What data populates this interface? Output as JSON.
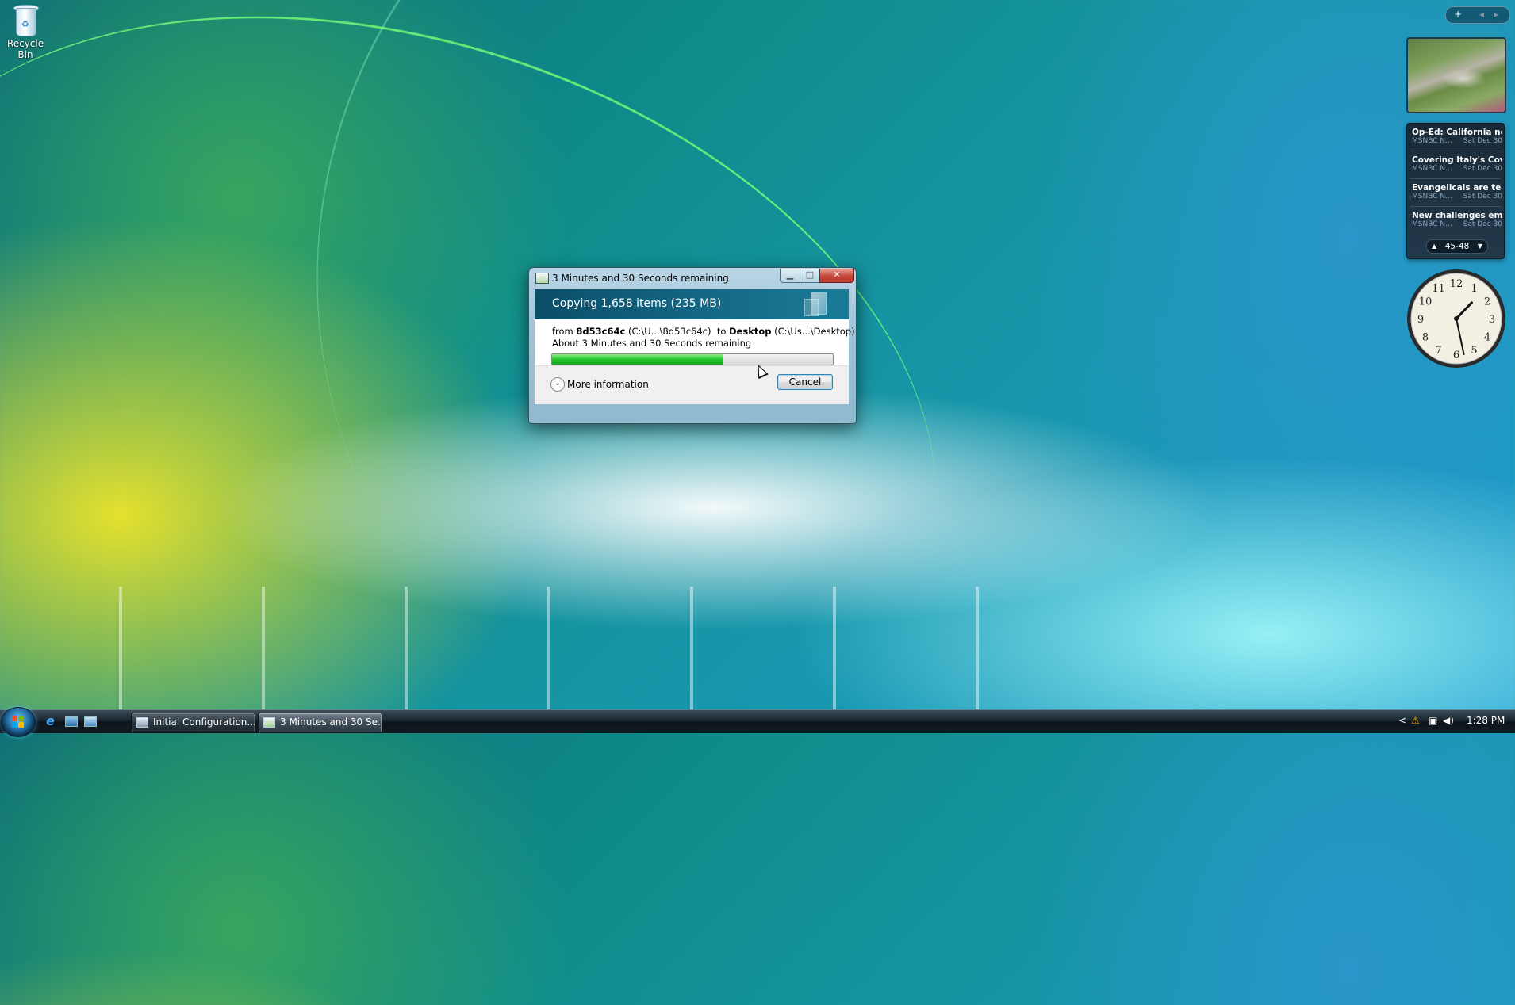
{
  "desktop": {
    "icons": [
      {
        "label": "Recycle Bin",
        "icon": "recycle-bin-icon"
      }
    ]
  },
  "dialog": {
    "title": "3 Minutes and 30 Seconds remaining",
    "heading": "Copying 1,658 items (235 MB)",
    "from_label": "from",
    "from_name": "8d53c64c",
    "from_path": "(C:\\U...\\8d53c64c)",
    "to_label": "to",
    "to_name": "Desktop",
    "to_path": "(C:\\Us...\\Desktop)",
    "status": "About 3 Minutes and 30 Seconds remaining",
    "progress": 0.61,
    "progress_color": "#23c42a",
    "more_info": "More information",
    "cancel": "Cancel",
    "controls": {
      "minimize": "minimize-icon",
      "maximize": "maximize-icon",
      "close": "close-icon"
    }
  },
  "sidebar": {
    "controls": {
      "add": "+",
      "prev": "◂",
      "next": "▸"
    },
    "news": {
      "items": [
        {
          "title": "Op-Ed: California nee...",
          "source": "MSNBC N...",
          "date": "Sat Dec 30"
        },
        {
          "title": "Covering Italy's Covi...",
          "source": "MSNBC N...",
          "date": "Sat Dec 30"
        },
        {
          "title": "Evangelicals are teac...",
          "source": "MSNBC N...",
          "date": "Sat Dec 30"
        },
        {
          "title": "New challenges eme...",
          "source": "MSNBC N...",
          "date": "Sat Dec 30"
        }
      ],
      "page": "45-48"
    },
    "clock": {
      "numbers": [
        "12",
        "1",
        "2",
        "3",
        "4",
        "5",
        "6",
        "7",
        "8",
        "9",
        "10",
        "11"
      ],
      "hour": 1,
      "minute": 28
    }
  },
  "taskbar": {
    "tasks": [
      {
        "label": "Initial Configuration..."
      },
      {
        "label": "3 Minutes and 30 Se..."
      }
    ],
    "quick_launch": [
      "internet-explorer-icon",
      "show-desktop-icon",
      "switch-windows-icon"
    ],
    "tray": {
      "chevron": "<"
    },
    "time": "1:28 PM"
  },
  "colors": {
    "accent": "#156a88",
    "taskbar": "#1a2630"
  }
}
